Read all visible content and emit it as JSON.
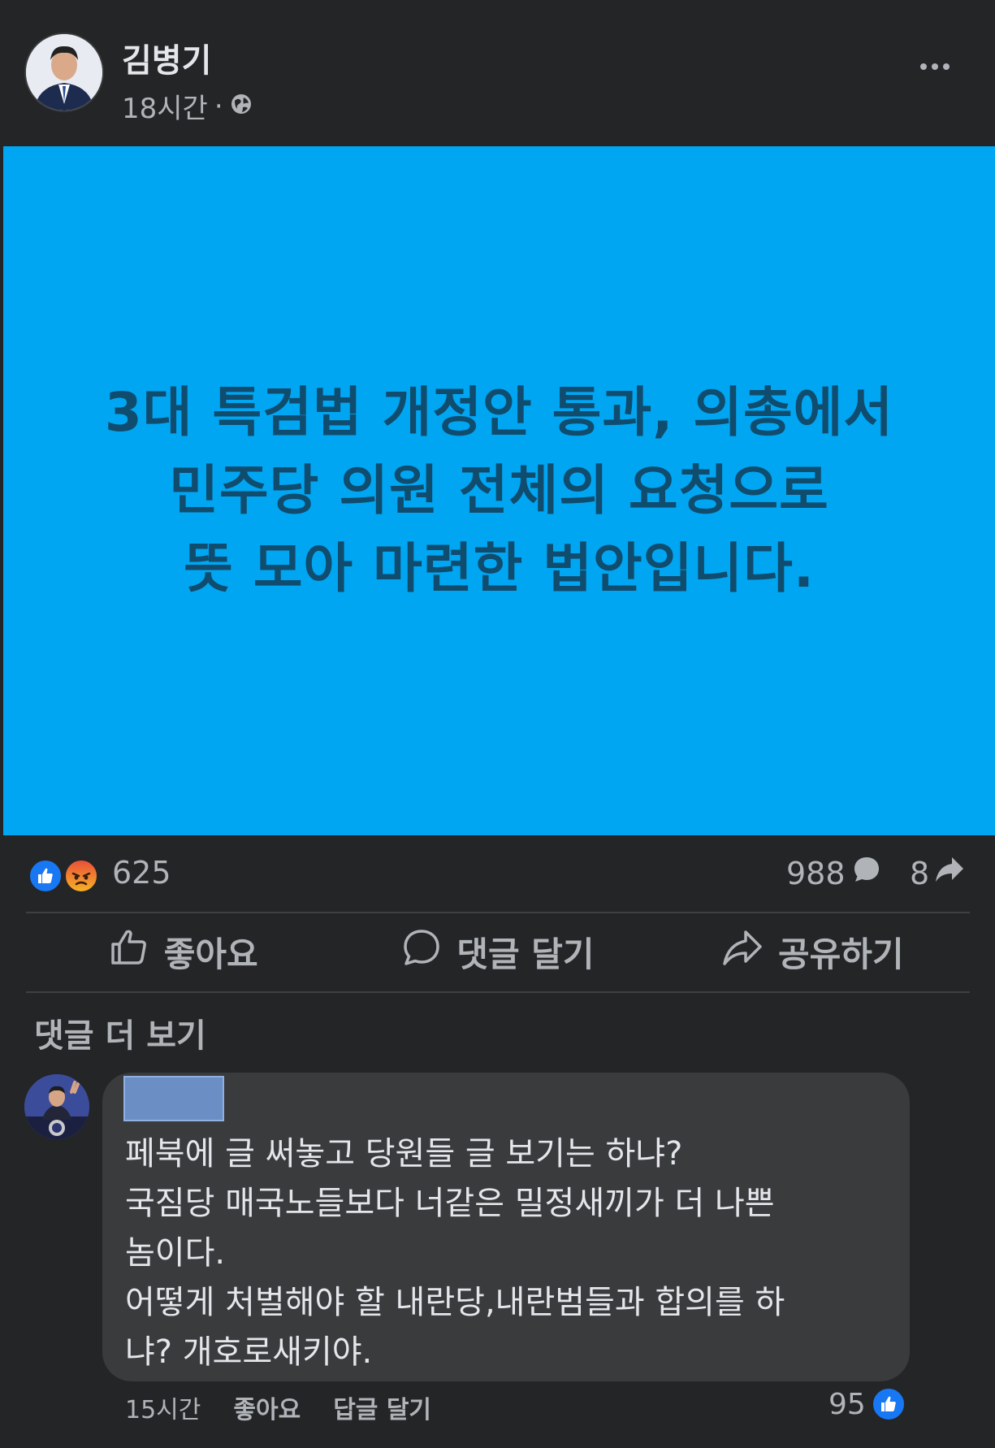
{
  "post": {
    "author": "김병기",
    "time": "18시간",
    "separator": "·",
    "text": "3대 특검법 개정안 통과, 의총에서\n민주당 의원 전체의 요청으로\n뜻 모아 마련한 법안입니다.",
    "background_color": "#00a6f2",
    "audience_icon": "globe-icon"
  },
  "counts": {
    "reactions": "625",
    "comments": "988",
    "shares": "8",
    "reaction_types": [
      "like",
      "angry"
    ]
  },
  "actions": {
    "like": "좋아요",
    "comment": "댓글 달기",
    "share": "공유하기"
  },
  "comments_section": {
    "more_comments": "댓글 더 보기",
    "comment": {
      "text": "페북에 글 써놓고 당원들 글 보기는 하냐?\n국짐당 매국노들보다 너같은 밀정새끼가 더 나쁜\n놈이다.\n어떻게 처벌해야 할 내란당,내란범들과 합의를 하\n냐? 개호로새키야.",
      "time": "15시간",
      "like_label": "좋아요",
      "reply_label": "답글 달기",
      "like_count": "95"
    }
  }
}
